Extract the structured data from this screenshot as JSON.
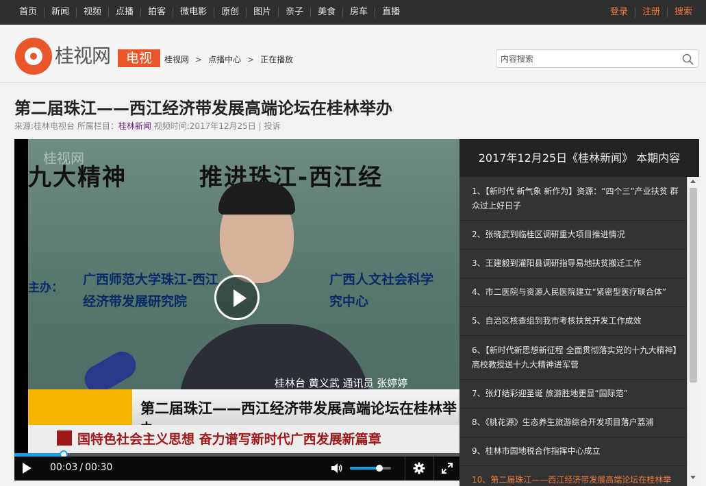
{
  "topnav": {
    "left": [
      "首页",
      "新闻",
      "视频",
      "点播",
      "拍客",
      "微电影",
      "原创",
      "图片",
      "亲子",
      "美食",
      "房车",
      "直播"
    ],
    "right": [
      "登录",
      "注册",
      "搜索"
    ]
  },
  "header": {
    "logo_text": "桂视网",
    "tv_badge": "电视",
    "breadcrumb": [
      "桂视网",
      "点播中心",
      "正在播放"
    ],
    "breadcrumb_sep": ">",
    "search_placeholder": "内容搜索"
  },
  "article": {
    "title": "第二届珠江——西江经济带发展高端论坛在桂林举办",
    "meta_source": "来源:桂林电视台 所属栏目：",
    "meta_column": "桂林新闻",
    "meta_time": " 视频时间:2017年12月25日 | ",
    "meta_report": "投诉"
  },
  "video": {
    "watermark": "桂视网",
    "slogan_left": "九大精神",
    "slogan_right": "推进珠江-西江经",
    "board_label": "主办：",
    "board_line1": "广西师范大学珠江-西江",
    "board_line2": "经济带发展研究院",
    "board_line3": "广西人文社会科学",
    "board_line4": "究中心",
    "reporter": "桂林台 黄义武 通讯员 张婷婷",
    "caption": "第二届珠江——西江经济带发展高端论坛在桂林举办",
    "ticker": "国特色社会主义思想 奋力谱写新时代广西发展新篇章"
  },
  "player": {
    "current_time": "00:03",
    "time_sep": "/",
    "duration": "00:30",
    "progress_fraction": 0.1,
    "volume_fraction": 0.72,
    "accent_color": "#1aa0e8"
  },
  "playlist": {
    "header": "2017年12月25日《桂林新闻》 本期内容",
    "items": [
      "1、【新时代 新气象 新作为】资源：“四个三”产业扶贫 群众过上好日子",
      "2、张晓武到临桂区调研重大项目推进情况",
      "3、王建毅到灌阳县调研指导易地扶贫搬迁工作",
      "4、市二医院与资源人民医院建立“紧密型医疗联合体”",
      "5、自治区核查组到我市考核扶贫开发工作成效",
      "6、【新时代新思想新征程 全面贯彻落实党的十九大精神】高校教授送十九大精神进军营",
      "7、张灯结彩迎圣诞 旅游胜地更显“国际范”",
      "8、《桃花源》生态养生旅游综合开发项目落户荔浦",
      "9、桂林市国地税合作指挥中心成立",
      "10、第二届珠江——西江经济带发展高端论坛在桂林举"
    ],
    "active_index": 9
  },
  "colors": {
    "brand_orange": "#e8562a",
    "nav_bg": "#2f2f2f",
    "link_purple": "#6a1f7a"
  }
}
